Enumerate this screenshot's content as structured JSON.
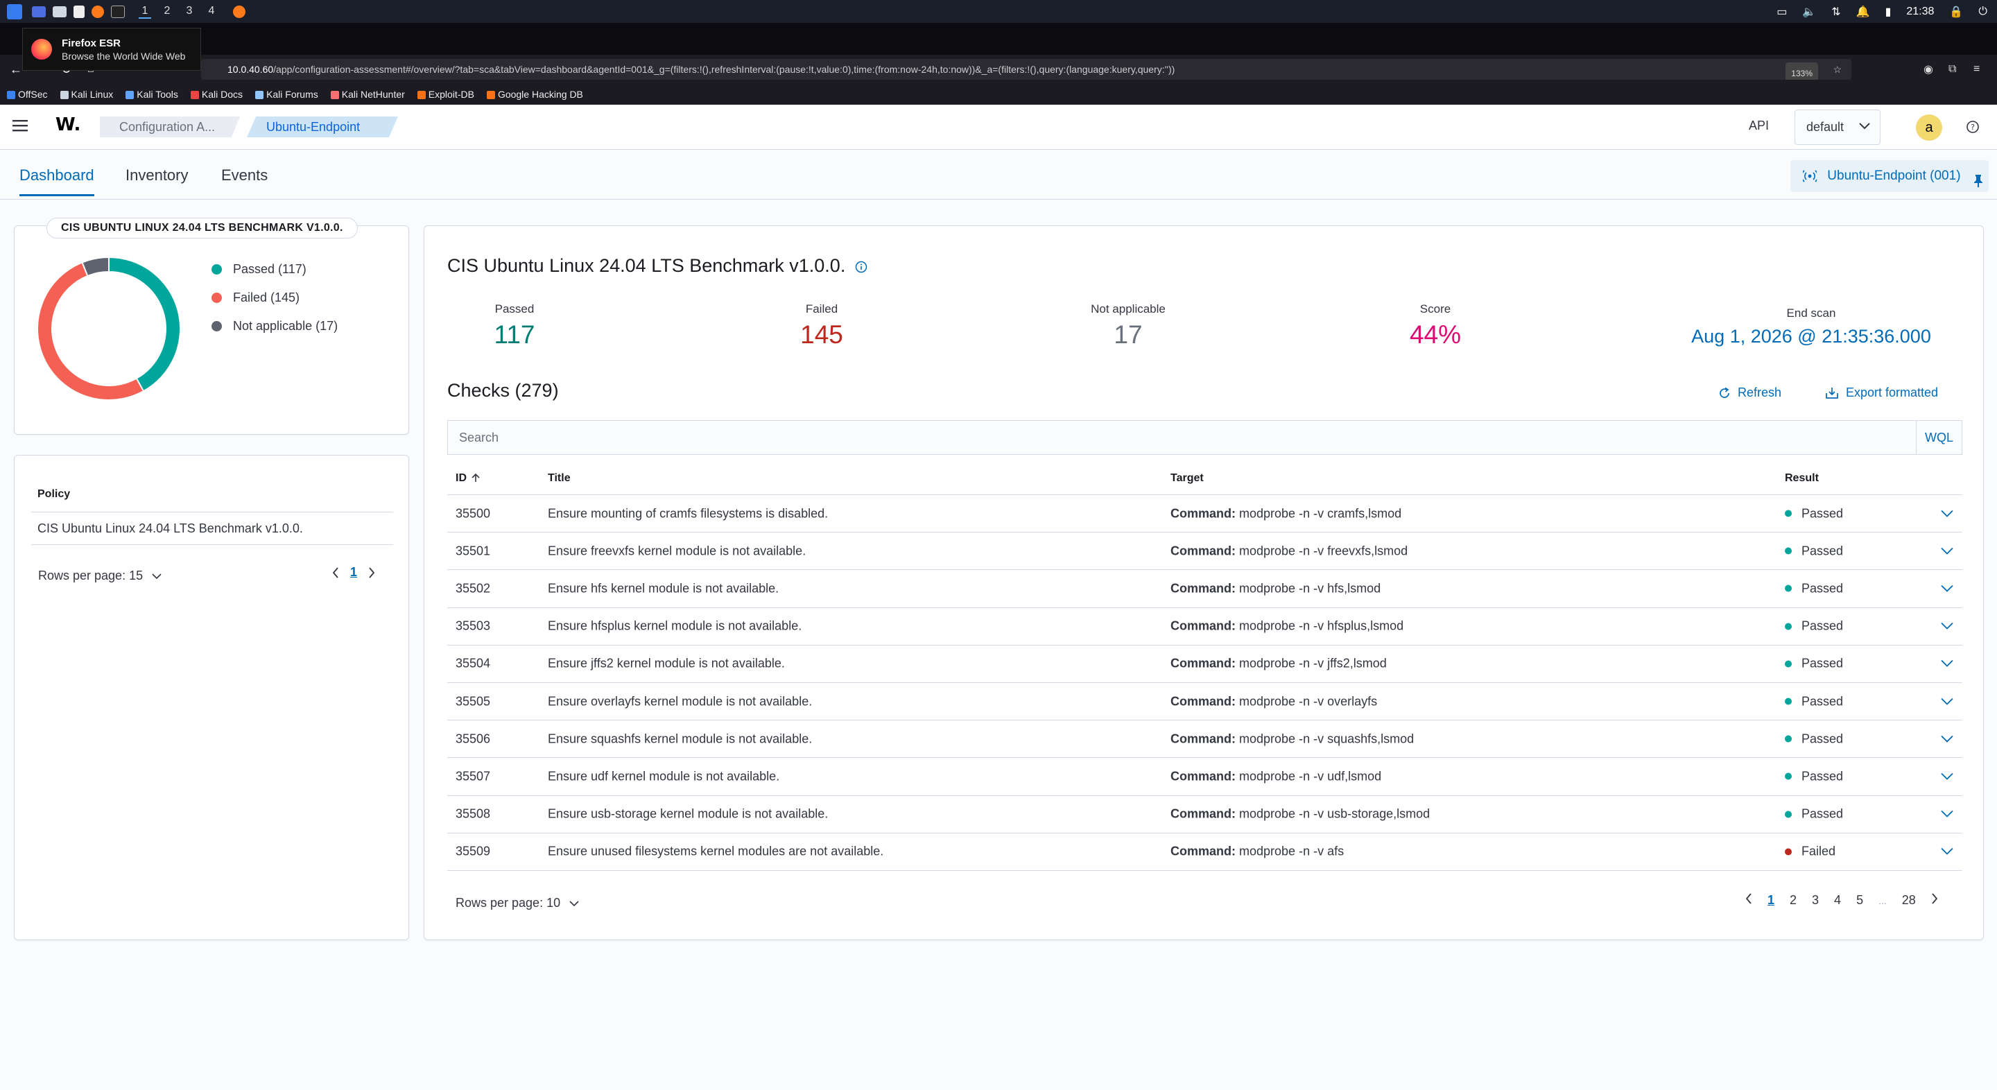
{
  "os": {
    "workspaces": [
      "1",
      "2",
      "3",
      "4"
    ],
    "clock": "21:38"
  },
  "browser": {
    "tooltip_title": "Firefox ESR",
    "tooltip_sub": "Browse the World Wide Web",
    "url_host": "10.0.40.60",
    "url_path": "/app/configuration-assessment#/overview/?tab=sca&tabView=dashboard&agentId=001&_g=(filters:!(),refreshInterval:(pause:!t,value:0),time:(from:now-24h,to:now))&_a=(filters:!(),query:(language:kuery,query:''))",
    "zoom": "133%",
    "bookmarks": [
      {
        "label": "OffSec",
        "color": "#3b82f6"
      },
      {
        "label": "Kali Linux",
        "color": "#cbd5e1"
      },
      {
        "label": "Kali Tools",
        "color": "#60a5fa"
      },
      {
        "label": "Kali Docs",
        "color": "#ef4444"
      },
      {
        "label": "Kali Forums",
        "color": "#93c5fd"
      },
      {
        "label": "Kali NetHunter",
        "color": "#f87171"
      },
      {
        "label": "Exploit-DB",
        "color": "#f97316"
      },
      {
        "label": "Google Hacking DB",
        "color": "#f97316"
      }
    ]
  },
  "header": {
    "logo": "W.",
    "breadcrumb_1": "Configuration A...",
    "breadcrumb_2": "Ubuntu-Endpoint",
    "api_label": "API",
    "env_value": "default",
    "avatar_letter": "a"
  },
  "tabs": [
    "Dashboard",
    "Inventory",
    "Events"
  ],
  "agent_button": "Ubuntu-Endpoint (001)",
  "summary": {
    "title": "CIS UBUNTU LINUX 24.04 LTS BENCHMARK V1.0.0.",
    "legend": [
      {
        "label": "Passed (117)",
        "color": "#00a69b"
      },
      {
        "label": "Failed (145)",
        "color": "#f46154"
      },
      {
        "label": "Not applicable (17)",
        "color": "#5e646f"
      }
    ],
    "donut_values": [
      117,
      145,
      17
    ]
  },
  "policy": {
    "label": "Policy",
    "name": "CIS Ubuntu Linux 24.04 LTS Benchmark v1.0.0.",
    "rows_per_page": "Rows per page: 15",
    "current_page": "1"
  },
  "benchmark": {
    "title": "CIS Ubuntu Linux 24.04 LTS Benchmark v1.0.0.",
    "stats": [
      {
        "label": "Passed",
        "value": "117",
        "color": "#017d73"
      },
      {
        "label": "Failed",
        "value": "145",
        "color": "#bd271e"
      },
      {
        "label": "Not applicable",
        "value": "17",
        "color": "#69707d"
      },
      {
        "label": "Score",
        "value": "44%",
        "color": "#dd0a73"
      },
      {
        "label": "End scan",
        "value": "Aug 1, 2026 @ 21:35:36.000",
        "color": "#006bb8"
      }
    ]
  },
  "checks": {
    "title": "Checks (279)",
    "refresh_label": "Refresh",
    "export_label": "Export formatted",
    "search_placeholder": "Search",
    "wql_label": "WQL",
    "columns": [
      "ID",
      "Title",
      "Target",
      "Result"
    ],
    "target_prefix": "Command:",
    "rows": [
      {
        "id": "35500",
        "title": "Ensure mounting of cramfs filesystems is disabled.",
        "target": "modprobe -n -v cramfs,lsmod",
        "result": "Passed"
      },
      {
        "id": "35501",
        "title": "Ensure freevxfs kernel module is not available.",
        "target": "modprobe -n -v freevxfs,lsmod",
        "result": "Passed"
      },
      {
        "id": "35502",
        "title": "Ensure hfs kernel module is not available.",
        "target": "modprobe -n -v hfs,lsmod",
        "result": "Passed"
      },
      {
        "id": "35503",
        "title": "Ensure hfsplus kernel module is not available.",
        "target": "modprobe -n -v hfsplus,lsmod",
        "result": "Passed"
      },
      {
        "id": "35504",
        "title": "Ensure jffs2 kernel module is not available.",
        "target": "modprobe -n -v jffs2,lsmod",
        "result": "Passed"
      },
      {
        "id": "35505",
        "title": "Ensure overlayfs kernel module is not available.",
        "target": "modprobe -n -v overlayfs",
        "result": "Passed"
      },
      {
        "id": "35506",
        "title": "Ensure squashfs kernel module is not available.",
        "target": "modprobe -n -v squashfs,lsmod",
        "result": "Passed"
      },
      {
        "id": "35507",
        "title": "Ensure udf kernel module is not available.",
        "target": "modprobe -n -v udf,lsmod",
        "result": "Passed"
      },
      {
        "id": "35508",
        "title": "Ensure usb-storage kernel module is not available.",
        "target": "modprobe -n -v usb-storage,lsmod",
        "result": "Passed"
      },
      {
        "id": "35509",
        "title": "Ensure unused filesystems kernel modules are not available.",
        "target": "modprobe -n -v afs",
        "result": "Failed"
      }
    ],
    "rows_per_page": "Rows per page: 10",
    "pages": [
      "1",
      "2",
      "3",
      "4",
      "5",
      "...",
      "28"
    ]
  },
  "colors": {
    "passed": "#00a69b",
    "failed": "#bd271e",
    "accent": "#006bb8"
  }
}
